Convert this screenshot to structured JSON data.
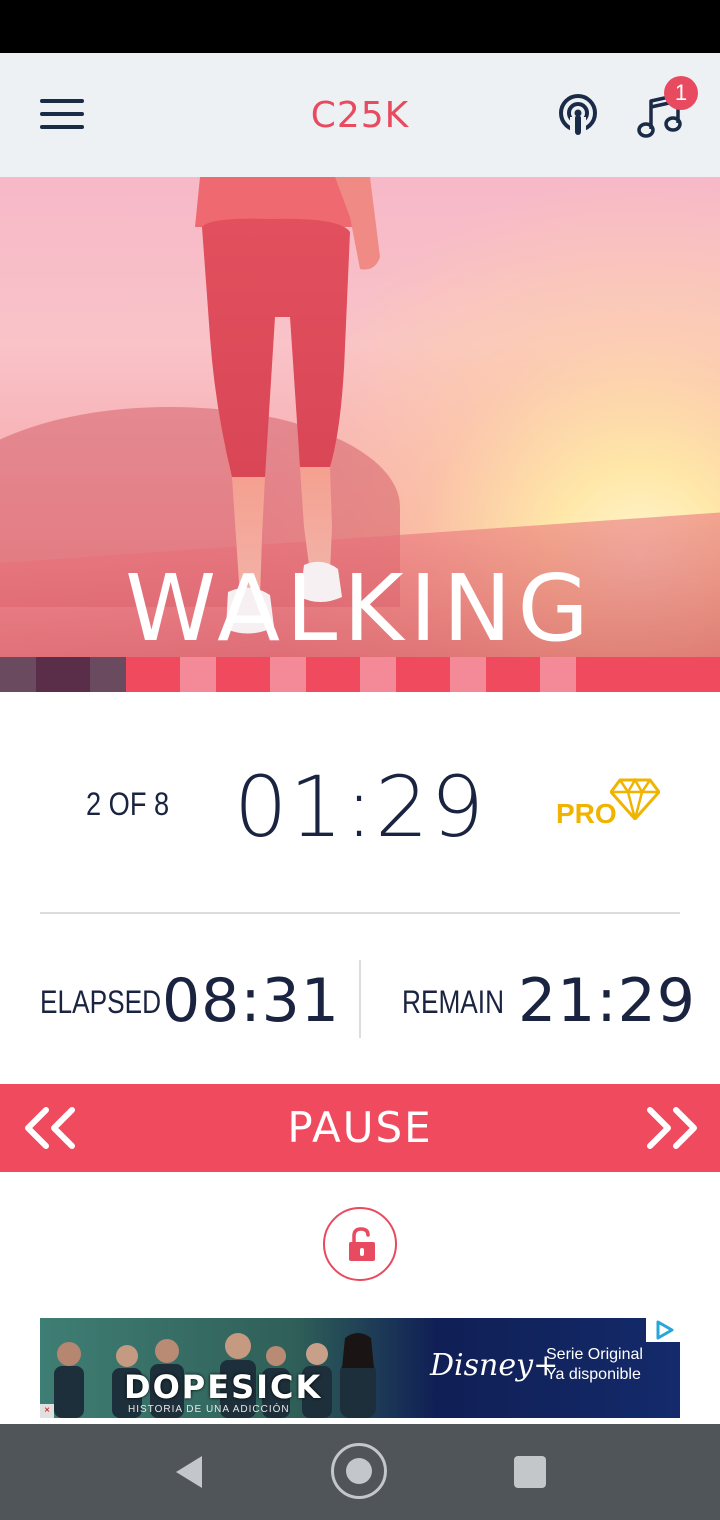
{
  "app": {
    "title": "C25K",
    "notification_count": "1",
    "accent_color": "#e84a5f"
  },
  "hero": {
    "activity": "WALKING"
  },
  "interval_progress": {
    "segments": [
      {
        "state": "done",
        "color": "#6a4a5e"
      },
      {
        "state": "current",
        "color": "#5a2d48"
      },
      {
        "state": "done",
        "color": "#6a4a5e"
      },
      {
        "state": "pending",
        "color": "#ef4a5e"
      },
      {
        "state": "pending",
        "color": "#f48a98"
      },
      {
        "state": "pending",
        "color": "#ef4a5e"
      },
      {
        "state": "pending",
        "color": "#f48a98"
      },
      {
        "state": "pending",
        "color": "#ef4a5e"
      },
      {
        "state": "pending",
        "color": "#f48a98"
      },
      {
        "state": "pending",
        "color": "#ef4a5e"
      },
      {
        "state": "pending",
        "color": "#f48a98"
      },
      {
        "state": "pending",
        "color": "#ef4a5e"
      },
      {
        "state": "pending",
        "color": "#f48a98"
      },
      {
        "state": "pending",
        "color": "#ef4a5e"
      }
    ]
  },
  "workout": {
    "step": "2 OF 8",
    "timer": "01:29",
    "pro_label": "PRO",
    "elapsed_label": "ELAPSED",
    "elapsed_value": "08:31",
    "remain_label": "REMAIN",
    "remain_value": "21:29"
  },
  "controls": {
    "pause_label": "PAUSE",
    "prev_icon": "double-chevron-left-icon",
    "next_icon": "double-chevron-right-icon",
    "lock_icon": "unlock-icon"
  },
  "ad": {
    "show_title": "DOPESICK",
    "show_subtitle": "HISTORIA DE UNA ADICCIÓN",
    "brand": "Disney+",
    "tagline_line1": "Serie Original",
    "tagline_line2": "Ya disponible"
  }
}
